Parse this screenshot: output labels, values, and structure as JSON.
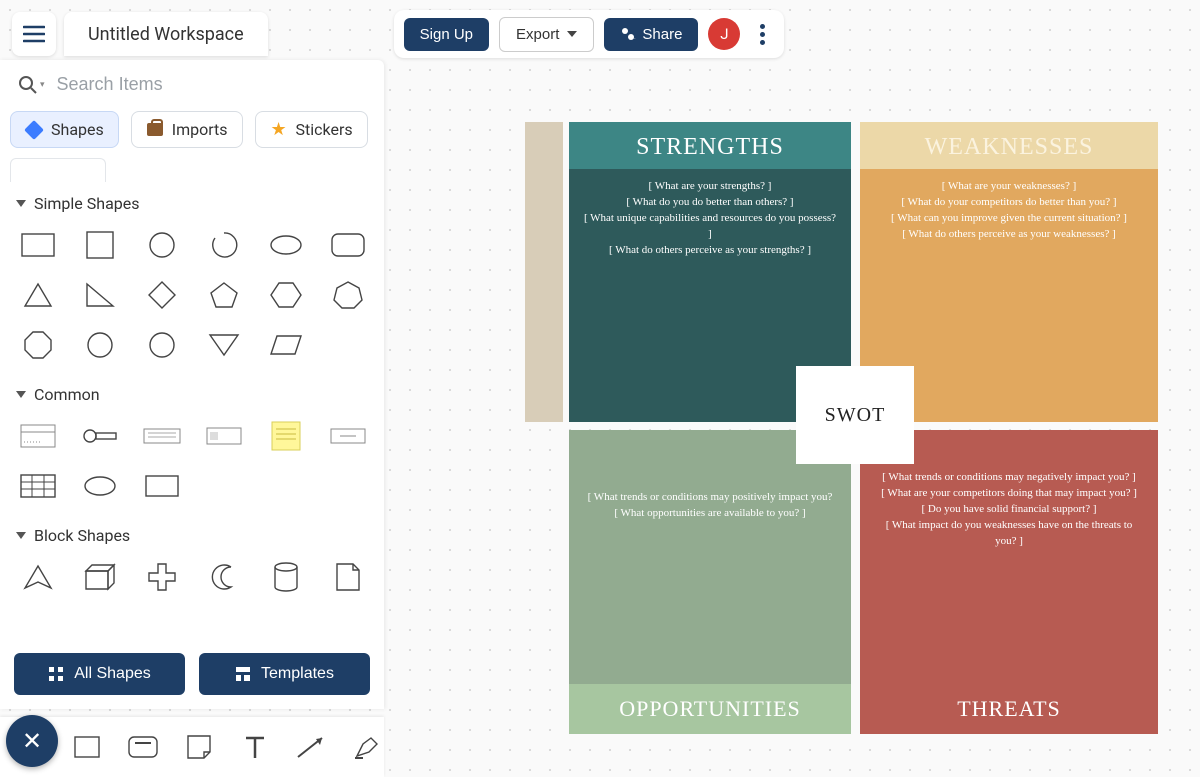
{
  "header": {
    "title": "Untitled Workspace",
    "signup_label": "Sign Up",
    "export_label": "Export",
    "share_label": "Share",
    "avatar_initial": "J"
  },
  "search": {
    "placeholder": "Search Items"
  },
  "panel_tabs": {
    "shapes": "Shapes",
    "imports": "Imports",
    "stickers": "Stickers"
  },
  "sections": {
    "simple": "Simple Shapes",
    "common": "Common",
    "block": "Block Shapes"
  },
  "panel_buttons": {
    "all_shapes": "All Shapes",
    "templates": "Templates"
  },
  "swot": {
    "center": "SWOT",
    "strengths": {
      "title": "STRENGTHS",
      "lines": [
        "[ What are your strengths? ]",
        "[ What do you do better than others? ]",
        "[ What unique capabilities and resources do you possess? ]",
        "[ What do others perceive as your strengths? ]"
      ]
    },
    "weaknesses": {
      "title": "WEAKNESSES",
      "lines": [
        "[ What are your weaknesses? ]",
        "[ What do your competitors do better than you? ]",
        "[ What can you improve given the current situation? ]",
        "[ What do others perceive as your weaknesses? ]"
      ]
    },
    "opportunities": {
      "title": "OPPORTUNITIES",
      "lines": [
        "[ What trends or conditions may positively impact you?",
        "[ What opportunities are available to you? ]"
      ]
    },
    "threats": {
      "title": "THREATS",
      "lines": [
        "[ What trends or conditions may negatively impact you? ]",
        "[ What are your competitors doing that may impact you? ]",
        "[ Do you have solid financial support? ]",
        "[ What impact do you weaknesses have on the threats to you? ]"
      ]
    }
  }
}
